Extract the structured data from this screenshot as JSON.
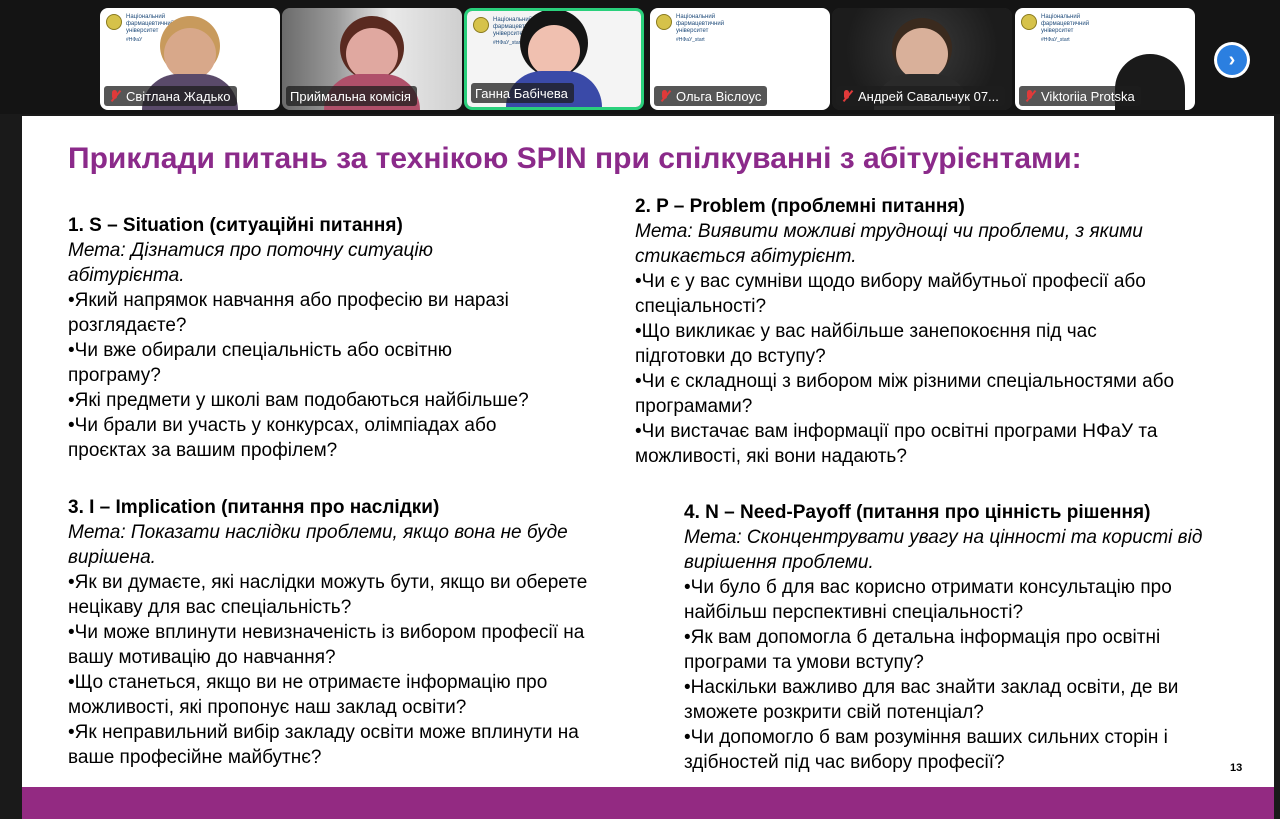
{
  "participants": [
    {
      "name": "Світлана Жадько",
      "muted": true,
      "active": false,
      "logo_text": "Національний фармацевтичний університет",
      "logo_tag": "#НФаУ"
    },
    {
      "name": "Приймальна комісія",
      "muted": false,
      "active": false,
      "logo_text": "",
      "logo_tag": ""
    },
    {
      "name": "Ганна Бабічева",
      "muted": false,
      "active": true,
      "logo_text": "Національний фармацевтичний університет",
      "logo_tag": "#НФаУ_start"
    },
    {
      "name": "Ольга Віслоус",
      "muted": true,
      "active": false,
      "logo_text": "Національний фармацевтичний університет",
      "logo_tag": "#НФаУ_start"
    },
    {
      "name": "Андрей Савальчук 07...",
      "muted": true,
      "active": false,
      "logo_text": "",
      "logo_tag": ""
    },
    {
      "name": "Viktoriia Protska",
      "muted": true,
      "active": false,
      "logo_text": "Національний фармацевтичний університет",
      "logo_tag": "#НФаУ_start"
    }
  ],
  "colors": {
    "title": "#8b2a8a",
    "footer": "#932a82",
    "active_border": "#2ad07c",
    "next_button": "#2b7fe0"
  },
  "slide": {
    "title": "Приклади питань за технікою SPIN при спілкуванні з абітурієнтами:",
    "page_number": "13",
    "sections": {
      "situation": {
        "heading": "1. S – Situation (ситуаційні питання)",
        "goal_line1": "Мета: Дізнатися про поточну ситуацію",
        "goal_line2": "абітурієнта.",
        "lines": [
          "•Який напрямок навчання або професію ви наразі",
          "розглядаєте?",
          "•Чи вже обирали спеціальність або освітню",
          "програму?",
          "•Які предмети у школі вам подобаються найбільше?",
          "•Чи брали ви участь у конкурсах, олімпіадах або",
          "проєктах за вашим профілем?"
        ]
      },
      "problem": {
        "heading": "2. P – Problem (проблемні питання)",
        "goal_line1": "Мета: Виявити можливі труднощі чи проблеми, з якими",
        "goal_line2": "стикається абітурієнт.",
        "lines": [
          "•Чи є у вас сумніви щодо вибору майбутньої професії або",
          "спеціальності?",
          "•Що викликає у вас найбільше занепокоєння під час",
          "підготовки до вступу?",
          "•Чи є складнощі з вибором між різними спеціальностями або",
          "програмами?",
          "•Чи вистачає вам інформації про освітні програми НФаУ та",
          "можливості, які вони надають?"
        ]
      },
      "implication": {
        "heading": "3. I – Implication (питання про наслідки)",
        "goal_line1": "Мета: Показати наслідки проблеми, якщо вона не буде",
        "goal_line2": "вирішена.",
        "lines": [
          "•Як ви думаєте, які наслідки можуть бути, якщо ви оберете",
          "нецікаву для вас спеціальність?",
          "•Чи може вплинути невизначеність із вибором професії на",
          "вашу мотивацію до навчання?",
          "•Що станеться, якщо ви не отримаєте інформацію про",
          "можливості, які пропонує наш заклад освіти?",
          "•Як неправильний вибір закладу освіти може вплинути на",
          "ваше професійне майбутнє?"
        ]
      },
      "need_payoff": {
        "heading": "4. N – Need-Payoff (питання про цінність рішення)",
        "goal_line1": "Мета: Сконцентрувати увагу на цінності та користі від",
        "goal_line2": "вирішення проблеми.",
        "lines": [
          "•Чи було б для вас корисно отримати консультацію про",
          "найбільш перспективні спеціальності?",
          "•Як вам допомогла б детальна інформація про освітні",
          "програми та умови вступу?",
          "•Наскільки важливо для вас знайти заклад освіти, де ви",
          "зможете розкрити свій потенціал?",
          "•Чи допомогло б вам розуміння ваших сильних сторін і",
          "здібностей під час вибору професії?"
        ]
      }
    }
  }
}
